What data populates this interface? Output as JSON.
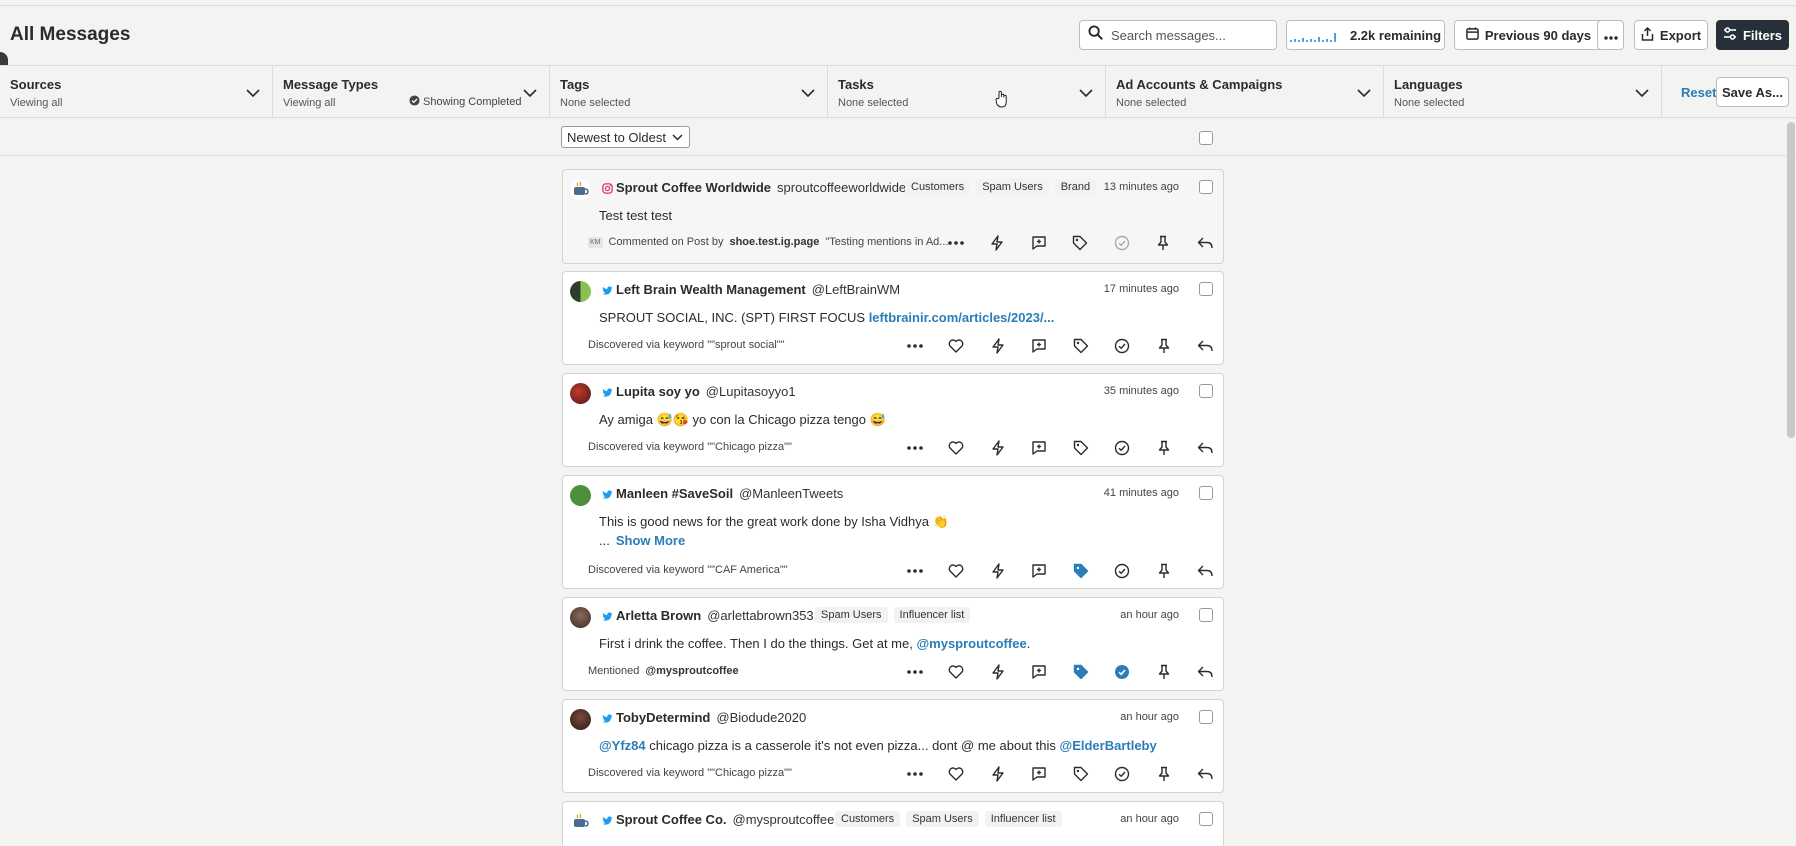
{
  "page": {
    "title": "All Messages"
  },
  "header": {
    "search_placeholder": "Search messages...",
    "remaining": "2.2k remaining",
    "date_range": "Previous 90 days",
    "export": "Export",
    "filters": "Filters"
  },
  "filters": [
    {
      "title": "Sources",
      "sub": "Viewing all"
    },
    {
      "title": "Message Types",
      "sub": "Viewing all",
      "extra": "Showing Completed"
    },
    {
      "title": "Tags",
      "sub": "None selected"
    },
    {
      "title": "Tasks",
      "sub": "None selected"
    },
    {
      "title": "Ad Accounts & Campaigns",
      "sub": "None selected"
    },
    {
      "title": "Languages",
      "sub": "None selected"
    }
  ],
  "filter_actions": {
    "reset": "Reset",
    "save_as": "Save As..."
  },
  "sort": {
    "selected": "Newest to Oldest"
  },
  "messages": [
    {
      "network": "instagram",
      "name": "Sprout Coffee Worldwide",
      "handle": "sproutcoffeeworldwide",
      "tags": [
        "Customers",
        "Spam Users",
        "Brand"
      ],
      "time": "13 minutes ago",
      "text": "Test test test",
      "meta_badge": "KM",
      "meta_prefix": "Commented on Post by",
      "meta_bold": "shoe.test.ig.page",
      "meta_suffix": "\"Testing mentions in Ad..."
    },
    {
      "network": "twitter",
      "name": "Left Brain Wealth Management",
      "handle": "@LeftBrainWM",
      "tags": [],
      "time": "17 minutes ago",
      "text": "SPROUT SOCIAL, INC. (SPT) FIRST FOCUS",
      "link": "leftbrainir.com/articles/2023/...",
      "meta_prefix": "Discovered via keyword \"\"sprout social\"\""
    },
    {
      "network": "twitter",
      "name": "Lupita soy yo",
      "handle": "@Lupitasoyyo1",
      "tags": [],
      "time": "35 minutes ago",
      "text": "Ay amiga 😅😘 yo con la Chicago pizza tengo 😅",
      "meta_prefix": "Discovered via keyword \"\"Chicago pizza\"\""
    },
    {
      "network": "twitter",
      "name": "Manleen #SaveSoil",
      "handle": "@ManleenTweets",
      "tags": [],
      "time": "41 minutes ago",
      "text": "This is good news for the great work done by Isha Vidhya 👏",
      "ellipsis": "...",
      "show_more": "Show More",
      "meta_prefix": "Discovered via keyword \"\"CAF America\"\""
    },
    {
      "network": "twitter",
      "name": "Arletta Brown",
      "handle": "@arlettabrown353",
      "tags": [
        "Spam Users",
        "Influencer list"
      ],
      "time": "an hour ago",
      "text": "First i drink the coffee. Then I do the things. Get at me,",
      "link": "@mysproutcoffee",
      "trail": ".",
      "meta_prefix": "Mentioned",
      "meta_bold": "@mysproutcoffee"
    },
    {
      "network": "twitter",
      "name": "TobyDetermind",
      "handle": "@Biodude2020",
      "tags": [],
      "time": "an hour ago",
      "lead_link": "@Yfz84",
      "text": "chicago pizza is a casserole it's not even pizza... dont @ me about this",
      "link": "@ElderBartleby",
      "meta_prefix": "Discovered via keyword \"\"Chicago pizza\"\""
    },
    {
      "network": "twitter",
      "name": "Sprout Coffee Co.",
      "handle": "@mysproutcoffee",
      "tags": [
        "Customers",
        "Spam Users",
        "Influencer list"
      ],
      "time": "an hour ago"
    }
  ],
  "colors": {
    "accent": "#2a7db8",
    "dark_button": "#273039",
    "twitter": "#1d9bf0",
    "instagram": "#e1306c"
  }
}
